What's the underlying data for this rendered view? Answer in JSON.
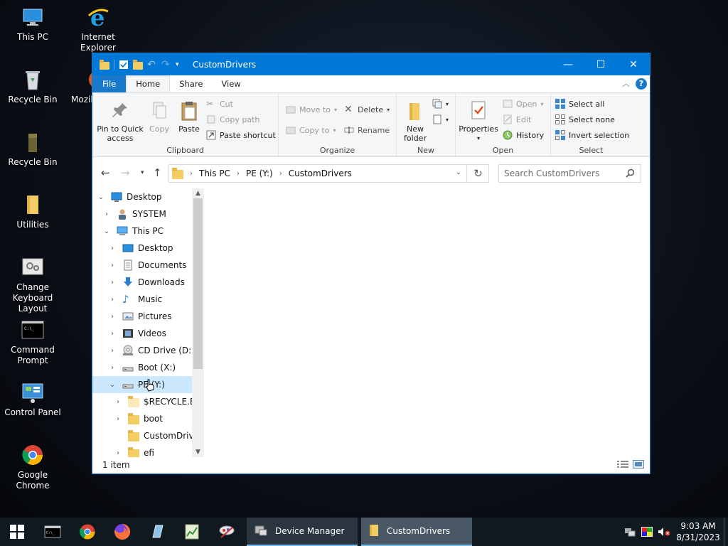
{
  "desktop": {
    "icons": [
      {
        "label": "This PC"
      },
      {
        "label": "Internet Explorer"
      },
      {
        "label": "Recycle Bin"
      },
      {
        "label": "Mozil"
      },
      {
        "label": "Recycle Bin"
      },
      {
        "label": "Utilities"
      },
      {
        "label": "Change Keyboard Layout"
      },
      {
        "label": "Command Prompt"
      },
      {
        "label": "Control Panel"
      },
      {
        "label": "Google Chrome"
      }
    ]
  },
  "window": {
    "title": "CustomDrivers",
    "controls": {
      "minimize": "—",
      "maximize": "☐",
      "close": "✕"
    },
    "tabs": [
      {
        "label": "File"
      },
      {
        "label": "Home"
      },
      {
        "label": "Share"
      },
      {
        "label": "View"
      }
    ],
    "help": "?",
    "ribbon": {
      "clipboard": {
        "name": "Clipboard",
        "pin": "Pin to Quick access",
        "copy": "Copy",
        "paste": "Paste",
        "cut": "Cut",
        "copy_path": "Copy path",
        "paste_shortcut": "Paste shortcut"
      },
      "organize": {
        "name": "Organize",
        "move_to": "Move to",
        "copy_to": "Copy to",
        "delete": "Delete",
        "rename": "Rename"
      },
      "new": {
        "name": "New",
        "new_folder": "New folder"
      },
      "open": {
        "name": "Open",
        "properties": "Properties",
        "open": "Open",
        "edit": "Edit",
        "history": "History"
      },
      "select": {
        "name": "Select",
        "select_all": "Select all",
        "select_none": "Select none",
        "invert_selection": "Invert selection"
      }
    },
    "address": {
      "segments": [
        "This PC",
        "PE (Y:)",
        "CustomDrivers"
      ],
      "search_placeholder": "Search CustomDrivers"
    },
    "tree": [
      {
        "label": "Desktop",
        "level": 0,
        "expanded": true
      },
      {
        "label": "SYSTEM",
        "level": 1,
        "expanded": false
      },
      {
        "label": "This PC",
        "level": 1,
        "expanded": true
      },
      {
        "label": "Desktop",
        "level": 2,
        "expanded": false
      },
      {
        "label": "Documents",
        "level": 2,
        "expanded": false
      },
      {
        "label": "Downloads",
        "level": 2,
        "expanded": false
      },
      {
        "label": "Music",
        "level": 2,
        "expanded": false
      },
      {
        "label": "Pictures",
        "level": 2,
        "expanded": false
      },
      {
        "label": "Videos",
        "level": 2,
        "expanded": false
      },
      {
        "label": "CD Drive (D:) v",
        "level": 2,
        "expanded": false
      },
      {
        "label": "Boot (X:)",
        "level": 2,
        "expanded": false
      },
      {
        "label": "PE (Y:)",
        "level": 2,
        "expanded": true,
        "selected": true
      },
      {
        "label": "$RECYCLE.BIN",
        "level": 3,
        "expanded": false
      },
      {
        "label": "boot",
        "level": 3,
        "expanded": false
      },
      {
        "label": "CustomDrivers",
        "level": 3,
        "expanded": null
      },
      {
        "label": "efi",
        "level": 3,
        "expanded": false
      }
    ],
    "status": "1 item"
  },
  "taskbar": {
    "tasks": [
      {
        "label": "Device Manager"
      },
      {
        "label": "CustomDrivers"
      }
    ],
    "clock": {
      "time": "9:03 AM",
      "date": "8/31/2023"
    }
  },
  "colors": {
    "titlebar": "#0078d7",
    "file_tab": "#1979ca",
    "selection": "#cce8ff",
    "folder": "#f3cd62"
  }
}
